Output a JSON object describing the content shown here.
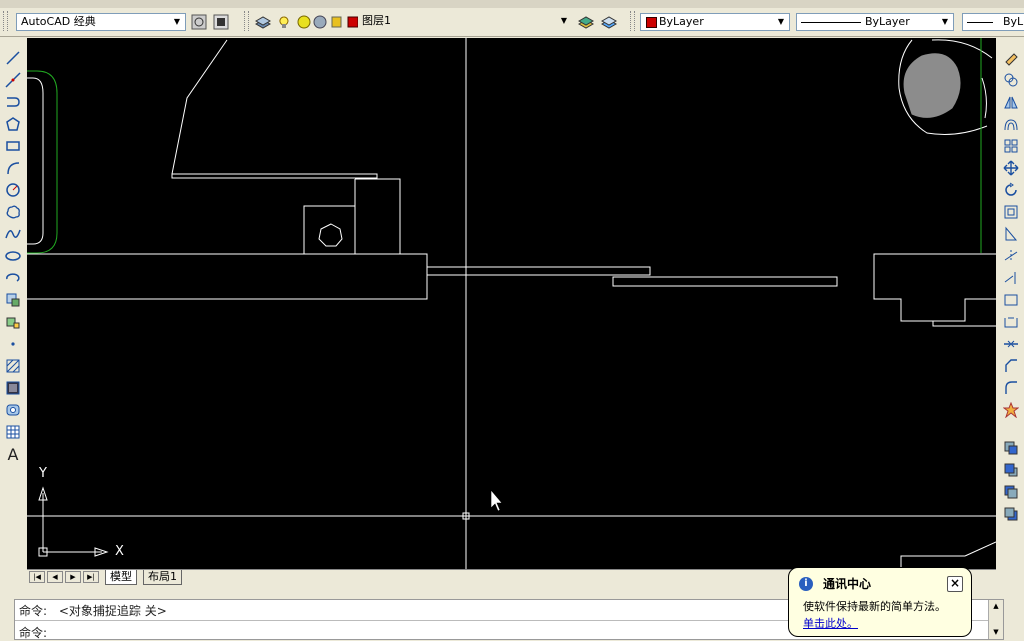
{
  "toolbar": {
    "workspace": "AutoCAD 经典",
    "layer": "图层1",
    "color": "ByLayer",
    "linetype": "ByLayer",
    "lineweight": "ByL"
  },
  "drawing": {
    "ucs_y": "Y",
    "ucs_x": "X"
  },
  "tabs": {
    "model": "模型",
    "layout1": "布局1"
  },
  "command": {
    "line1_prompt": "命令:",
    "line1_text": "<对象捕捉追踪 关>",
    "line2_prompt": "命令:"
  },
  "balloon": {
    "title": "通讯中心",
    "message": "使软件保持最新的简单方法。",
    "link": "单击此处。",
    "close": "×"
  },
  "colors": {
    "drawing_bg": "#000000",
    "lines": "#ffffff",
    "layer_red": "#cc0000",
    "accent_green": "#22aa22",
    "link_blue": "#0000cc"
  },
  "left_toolbar_icons": [
    "line-icon",
    "construction-line-icon",
    "polyline-icon",
    "polygon-icon",
    "rectangle-icon",
    "arc-icon",
    "circle-icon",
    "revision-cloud-icon",
    "spline-icon",
    "ellipse-icon",
    "ellipse-arc-icon",
    "insert-block-icon",
    "make-block-icon",
    "point-icon",
    "hatch-icon",
    "gradient-icon",
    "region-icon",
    "table-icon",
    "multiline-text-icon"
  ],
  "right_toolbar_icons": [
    "erase-icon",
    "copy-icon",
    "mirror-icon",
    "offset-icon",
    "array-icon",
    "move-icon",
    "rotate-icon",
    "scale-icon",
    "stretch-icon",
    "trim-icon",
    "extend-icon",
    "break-at-point-icon",
    "break-icon",
    "join-icon",
    "chamfer-icon",
    "fillet-icon",
    "explode-icon",
    "draworder-front-icon",
    "draworder-back-icon",
    "draworder-above-icon",
    "draworder-under-icon"
  ]
}
